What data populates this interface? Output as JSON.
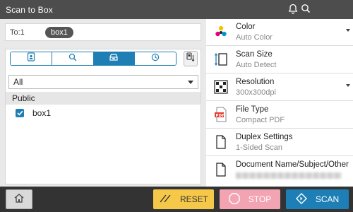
{
  "title": "Scan to Box",
  "header_icons": [
    "bell-icon",
    "search-icon"
  ],
  "to_field": {
    "label": "To:1",
    "chip": "box1"
  },
  "tabs": [
    {
      "name": "user-box-icon",
      "active": false
    },
    {
      "name": "search-icon",
      "active": false
    },
    {
      "name": "box-icon",
      "active": true
    },
    {
      "name": "clock-icon",
      "active": false
    }
  ],
  "filter": {
    "selected": "All"
  },
  "list": {
    "group": "Public",
    "items": [
      {
        "label": "box1",
        "checked": true
      }
    ]
  },
  "settings": [
    {
      "label": "Color",
      "value": "Auto Color",
      "icon": "color-dots-icon"
    },
    {
      "label": "Scan Size",
      "value": "Auto Detect",
      "icon": "scan-size-icon"
    },
    {
      "label": "Resolution",
      "value": "300x300dpi",
      "icon": "resolution-grid-icon"
    },
    {
      "label": "File Type",
      "value": "Compact PDF",
      "icon": "pdf-file-icon"
    },
    {
      "label": "Duplex Settings",
      "value": "1-Sided Scan",
      "icon": "document-icon"
    },
    {
      "label": "Document Name/Subject/Other",
      "value": "",
      "icon": "document-icon"
    }
  ],
  "buttons": {
    "reset": "RESET",
    "stop": "STOP",
    "scan": "SCAN"
  },
  "colors": {
    "accent": "#1e7fb6",
    "reset": "#f6c84a",
    "stop": "#f3a4b3",
    "header": "#4d4d4d"
  }
}
